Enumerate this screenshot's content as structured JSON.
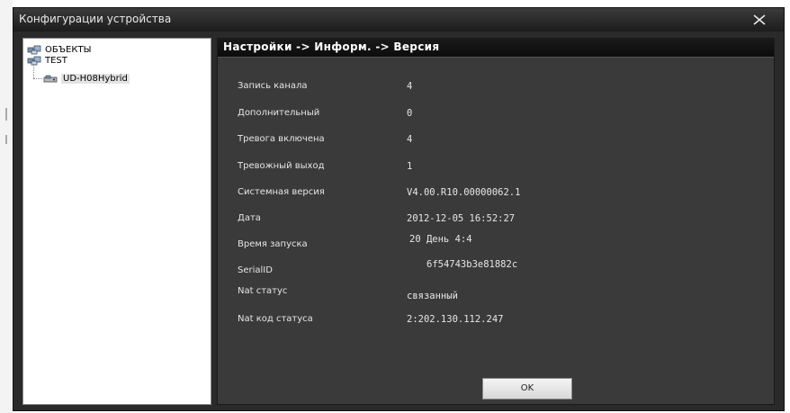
{
  "window": {
    "title": "Конфигурации устройства"
  },
  "tree": {
    "items": [
      {
        "label": "ОБЪЕКТЫ",
        "icon": "folder-group-icon"
      },
      {
        "label": "TEST",
        "icon": "folder-group-icon"
      },
      {
        "label": "UD-H08Hybrid",
        "icon": "dvr-device-icon"
      }
    ]
  },
  "panel": {
    "header": "Настройки -> Информ. -> Версия",
    "rows": [
      {
        "label": "Запись канала",
        "value": "4"
      },
      {
        "label": "Дополнительный",
        "value": "0"
      },
      {
        "label": "Тревога включена",
        "value": "4"
      },
      {
        "label": "Тревожный выход",
        "value": "1"
      },
      {
        "label": "Системная версия",
        "value": "V4.00.R10.00000062.1"
      },
      {
        "label": "Дата",
        "value": "2012-12-05 16:52:27"
      },
      {
        "label": "Время запуска",
        "value": "20 День 4:4"
      },
      {
        "label": "SerialID",
        "value": "6f54743b3e81882c"
      },
      {
        "label": "Nat статус",
        "value": "связанный"
      },
      {
        "label": "Nat код статуса",
        "value": "2:202.130.112.247"
      }
    ],
    "ok_label": "OK"
  }
}
